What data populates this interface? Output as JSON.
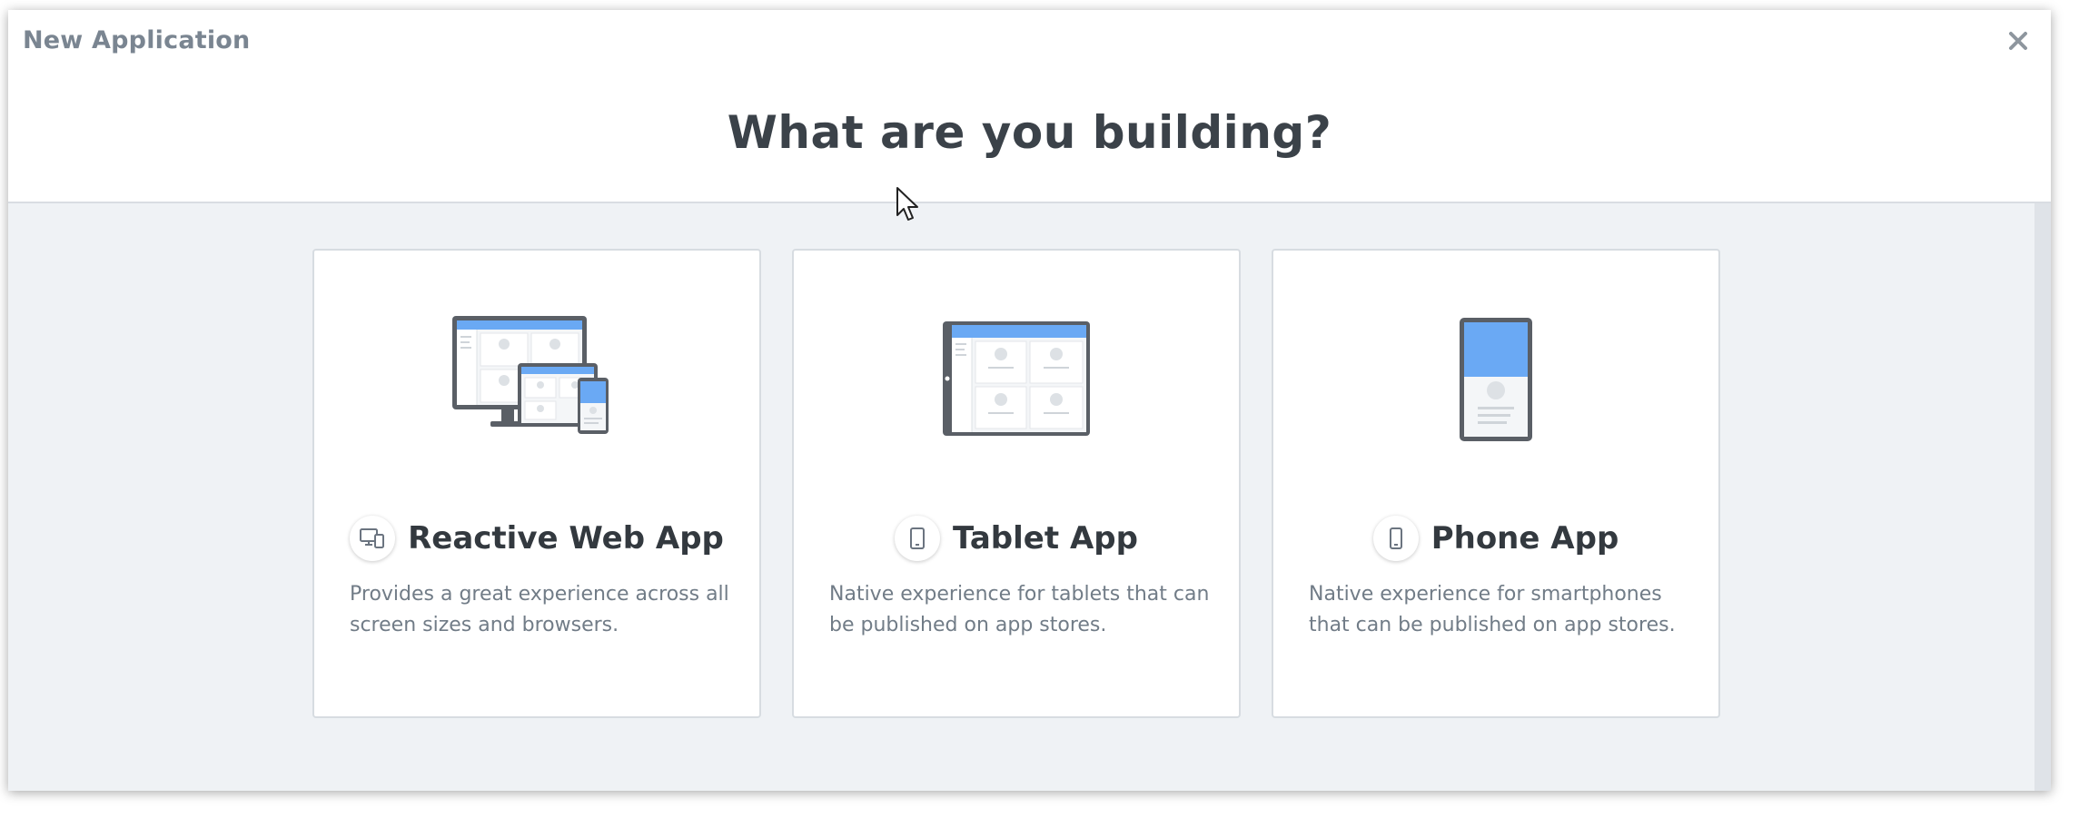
{
  "dialog": {
    "title": "New Application",
    "heading": "What are you building?"
  },
  "cards": [
    {
      "title": "Reactive Web App",
      "description": "Provides a great experience across all screen sizes and browsers.",
      "icon": "devices-icon",
      "illustration": "multi-device-illustration"
    },
    {
      "title": "Tablet App",
      "description": "Native experience for tablets that can be published on app stores.",
      "icon": "tablet-icon",
      "illustration": "tablet-illustration"
    },
    {
      "title": "Phone App",
      "description": "Native experience for smartphones that can be published on app stores.",
      "icon": "phone-icon",
      "illustration": "phone-illustration"
    }
  ],
  "colors": {
    "accent": "#6aa9f4",
    "device_frame": "#5a5f66",
    "panel_bg": "#eff2f5",
    "heading": "#3b4249",
    "muted_text": "#717c87"
  }
}
